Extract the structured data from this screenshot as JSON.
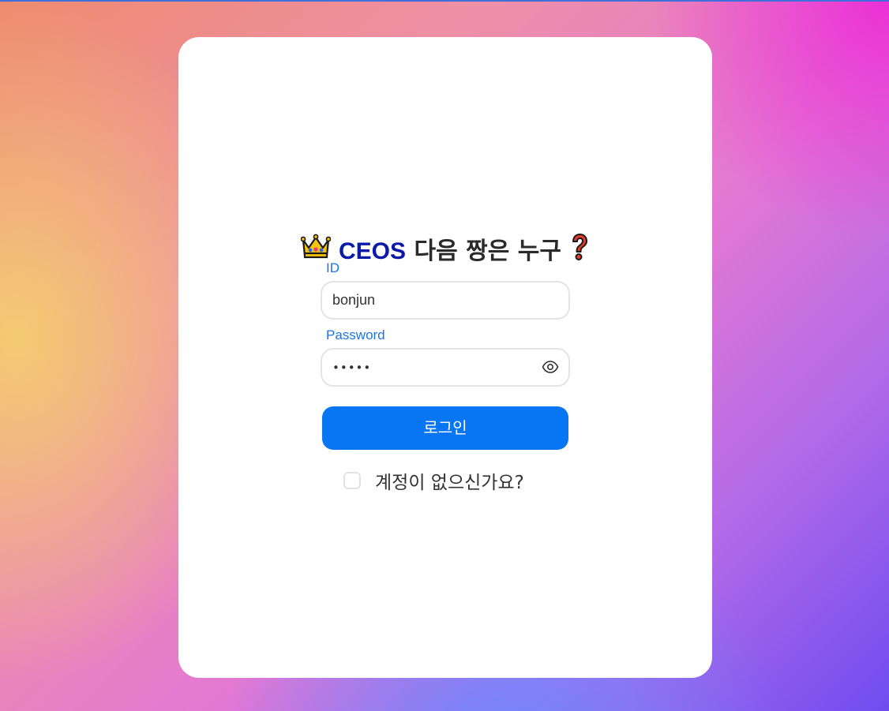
{
  "login": {
    "title_brand": "CEOS",
    "title_rest": "다음 짱은 누구",
    "title_emoji_left": "crown-emoji",
    "title_emoji_right": "red-question-mark-emoji",
    "id_label": "ID",
    "id_value": "bonjun",
    "password_label": "Password",
    "password_masked": "•••••",
    "password_toggle_icon": "eye-icon",
    "login_button": "로그인",
    "signup_text": "계정이 없으신가요?",
    "signup_checked": false
  },
  "colors": {
    "brand": "#0a1aa8",
    "label": "#1d74e6",
    "primary_button": "#0876f3"
  }
}
